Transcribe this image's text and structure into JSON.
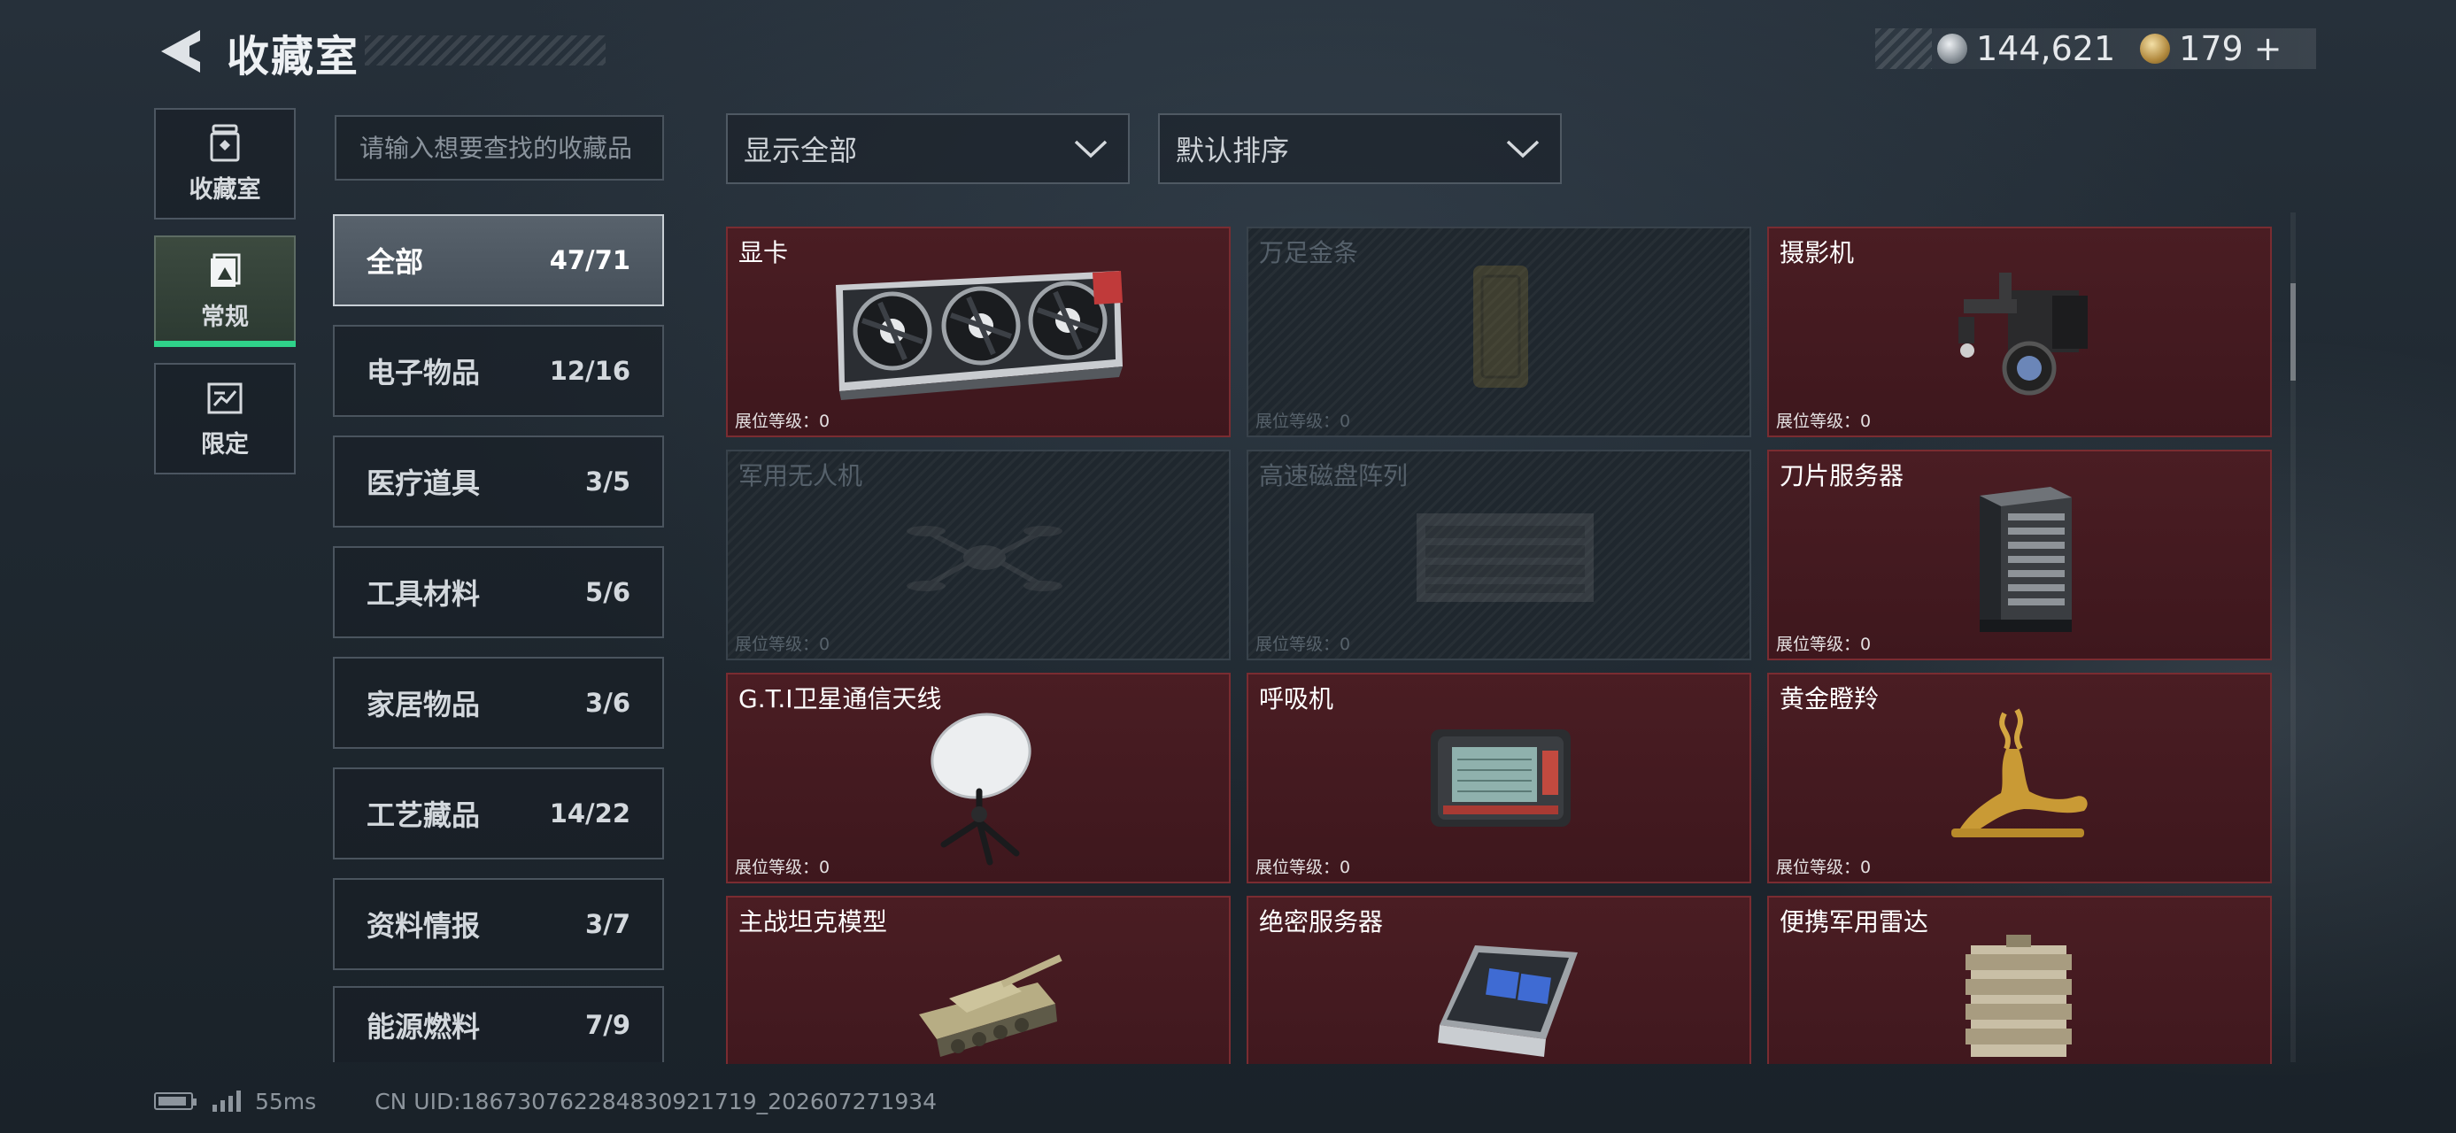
{
  "header": {
    "title": "收藏室"
  },
  "currency": {
    "silver_value": "144,621",
    "gold_value": "179",
    "gold_plus": "+"
  },
  "nav": [
    {
      "label": "收藏室",
      "icon": "collection-room-icon"
    },
    {
      "label": "常规",
      "icon": "regular-icon",
      "active": true
    },
    {
      "label": "限定",
      "icon": "limited-icon"
    }
  ],
  "search": {
    "placeholder": "请输入想要查找的收藏品"
  },
  "categories": [
    {
      "name": "全部",
      "count": "47/71",
      "active": true
    },
    {
      "name": "电子物品",
      "count": "12/16"
    },
    {
      "name": "医疗道具",
      "count": "3/5"
    },
    {
      "name": "工具材料",
      "count": "5/6"
    },
    {
      "name": "家居物品",
      "count": "3/6"
    },
    {
      "name": "工艺藏品",
      "count": "14/22"
    },
    {
      "name": "资料情报",
      "count": "3/7"
    },
    {
      "name": "能源燃料",
      "count": "7/9"
    }
  ],
  "filters": {
    "show_label": "显示全部",
    "sort_label": "默认排序"
  },
  "items": [
    {
      "name": "显卡",
      "level": "展位等级：0",
      "locked": false,
      "icon": "graphics-card-icon"
    },
    {
      "name": "万足金条",
      "level": "展位等级：0",
      "locked": true,
      "icon": "gold-bar-icon"
    },
    {
      "name": "摄影机",
      "level": "展位等级：0",
      "locked": false,
      "icon": "camera-icon"
    },
    {
      "name": "军用无人机",
      "level": "展位等级：0",
      "locked": true,
      "icon": "drone-icon"
    },
    {
      "name": "高速磁盘阵列",
      "level": "展位等级：0",
      "locked": true,
      "icon": "disk-array-icon"
    },
    {
      "name": "刀片服务器",
      "level": "展位等级：0",
      "locked": false,
      "icon": "blade-server-icon"
    },
    {
      "name": "G.T.I卫星通信天线",
      "level": "展位等级：0",
      "locked": false,
      "icon": "satellite-antenna-icon"
    },
    {
      "name": "呼吸机",
      "level": "展位等级：0",
      "locked": false,
      "icon": "ventilator-icon"
    },
    {
      "name": "黄金瞪羚",
      "level": "展位等级：0",
      "locked": false,
      "icon": "golden-gazelle-icon"
    },
    {
      "name": "主战坦克模型",
      "level": "",
      "locked": false,
      "icon": "tank-model-icon"
    },
    {
      "name": "绝密服务器",
      "level": "",
      "locked": false,
      "icon": "secret-server-icon"
    },
    {
      "name": "便携军用雷达",
      "level": "",
      "locked": false,
      "icon": "military-radar-icon"
    }
  ],
  "footer": {
    "ping": "55ms",
    "uid": "CN UID:18673076228483092171​9_202607271934"
  },
  "colors": {
    "accent_green": "#2fd28a",
    "card_red": "#4a1d23",
    "card_border": "#7a2c31"
  }
}
